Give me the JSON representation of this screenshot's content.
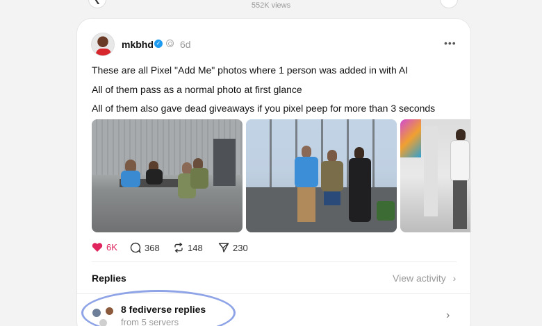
{
  "top_bar": {
    "views": "552K views",
    "back_icon": "chevron-left-icon",
    "more_icon": "ellipsis-icon"
  },
  "post": {
    "author": "mkbhd",
    "time": "6d",
    "lines": [
      "These are all Pixel \"Add Me\" photos where 1 person was added in with AI",
      "All of them pass as a normal photo at first glance",
      "All of them also gave dead giveaways if you pixel peep for more than 3 seconds"
    ],
    "photo_icons": [
      "photo-1",
      "photo-2",
      "photo-3"
    ],
    "actions": {
      "likes": "6K",
      "comments": "368",
      "reposts": "148",
      "shares": "230"
    },
    "like_color": "#e0245e"
  },
  "replies": {
    "heading": "Replies",
    "view_activity": "View activity",
    "fediverse_title": "8 fediverse replies",
    "fediverse_subtitle": "from 5 servers"
  },
  "highlight_color": "#8ea4e6"
}
